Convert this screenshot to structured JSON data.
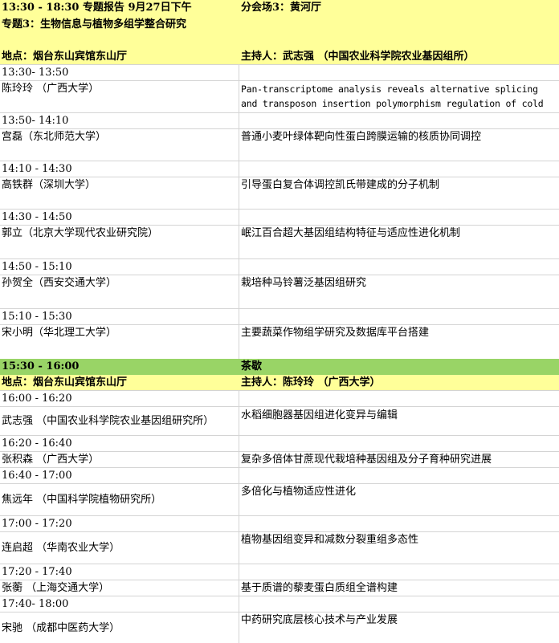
{
  "header": {
    "time_title": "13:30 - 18:30 专题报告 9月27日下午",
    "venue_room": "分会场3：黄河厅",
    "topic": "专题3：生物信息与植物多组学整合研究"
  },
  "session1": {
    "location": "地点：烟台东山宾馆东山厅",
    "host": "主持人：武志强 （中国农业科学院农业基因组所）",
    "talks": [
      {
        "time": "13:30- 13:50",
        "speaker": "陈玲玲 （广西大学）",
        "title_lines": [
          "Pan-transcriptome analysis reveals alternative splicing",
          "and transposon insertion polymorphism regulation of cold"
        ]
      },
      {
        "time": "13:50- 14:10",
        "speaker": "宫磊（东北师范大学）",
        "title": "普通小麦叶绿体靶向性蛋白跨膜运输的核质协同调控"
      },
      {
        "time": "14:10 - 14:30",
        "speaker": "高铁群（深圳大学）",
        "title": "引导蛋白复合体调控凯氏带建成的分子机制"
      },
      {
        "time": "14:30 - 14:50",
        "speaker": "郭立（北京大学现代农业研究院）",
        "title": "岷江百合超大基因组结构特征与适应性进化机制"
      },
      {
        "time": "14:50 - 15:10",
        "speaker": "孙贺全（西安交通大学）",
        "title": "栽培种马铃薯泛基因组研究"
      },
      {
        "time": "15:10 - 15:30",
        "speaker": "宋小明（华北理工大学）",
        "title": "主要蔬菜作物组学研究及数据库平台搭建"
      }
    ]
  },
  "break": {
    "time": "15:30 - 16:00",
    "label": "茶歇"
  },
  "session2": {
    "location": "地点：烟台东山宾馆东山厅",
    "host": "主持人：陈玲玲 （广西大学）",
    "talks": [
      {
        "time": "16:00 - 16:20",
        "speaker": "武志强 （中国农业科学院农业基因组研究所）",
        "title": "水稻细胞器基因组进化变异与编辑"
      },
      {
        "time": "16:20 - 16:40",
        "speaker": "张积森 （广西大学）",
        "title": "复杂多倍体甘蔗现代栽培种基因组及分子育种研究进展"
      },
      {
        "time": "16:40 - 17:00",
        "speaker": "焦远年 （中国科学院植物研究所）",
        "title": "多倍化与植物适应性进化"
      },
      {
        "time": "17:00 - 17:20",
        "speaker": "连启超 （华南农业大学）",
        "title": "植物基因组变异和减数分裂重组多态性"
      },
      {
        "time": "17:20 - 17:40",
        "speaker": "张蘅 （上海交通大学）",
        "title": "基于质谱的藜麦蛋白质组全谱构建"
      },
      {
        "time": "17:40- 18:00",
        "speaker": "宋驰 （成都中医药大学）",
        "title": "中药研究底层核心技术与产业发展"
      }
    ]
  }
}
